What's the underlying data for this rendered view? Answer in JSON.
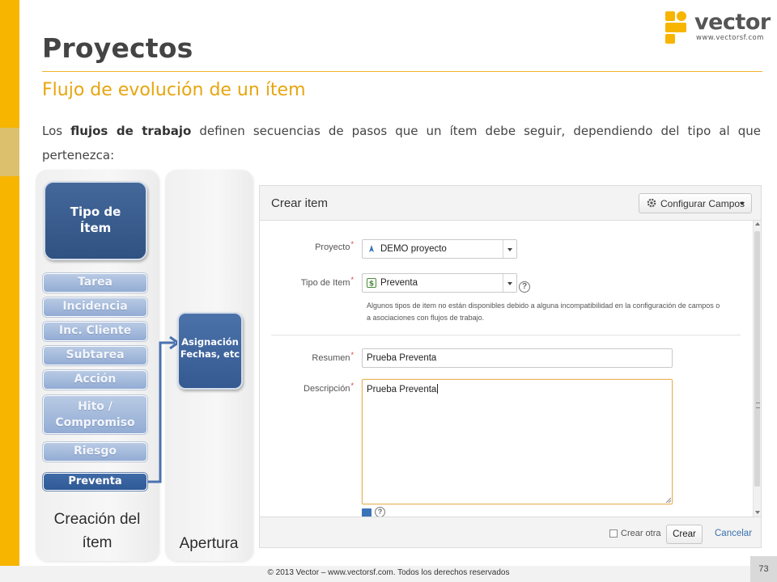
{
  "slide": {
    "title": "Proyectos",
    "subtitle": "Flujo de evolución de un ítem",
    "body_prefix": "Los ",
    "body_bold": "flujos de trabajo",
    "body_suffix": " definen secuencias de pasos que un ítem debe seguir, dependiendo del tipo al que pertenezca:",
    "footer": "© 2013 Vector – www.vectorsf.com. Todos los derechos reservados",
    "page_number": "73"
  },
  "logo": {
    "word": "vector",
    "url": "www.vectorsf.com",
    "color": "#f7b500"
  },
  "flow": {
    "tipo_line1": "Tipo de",
    "tipo_line2": "Ítem",
    "types": [
      "Tarea",
      "Incidencia",
      "Inc. Cliente",
      "Subtarea",
      "Acción",
      "Hito /",
      "Compromiso",
      "Riesgo",
      "Preventa"
    ],
    "active_type": "Preventa",
    "column1_line1": "Creación del",
    "column1_line2": "ítem",
    "column2": "Apertura",
    "step_line1": "Asignación",
    "step_line2": "Fechas, etc",
    "arrow_color": "#4a72b0"
  },
  "dialog": {
    "title": "Crear item",
    "config_button": "Configurar Campos",
    "fields": {
      "proyecto_label": "Proyecto",
      "proyecto_value": "DEMO proyecto",
      "tipo_label": "Tipo de Item",
      "tipo_value": "Preventa",
      "note": "Algunos tipos de item no están disponibles debido a alguna incompatibilidad en la configuración de campos o a asociaciones con flujos de trabajo.",
      "resumen_label": "Resumen",
      "resumen_value": "Prueba Preventa",
      "descripcion_label": "Descripción",
      "descripcion_value": "Prueba Preventa",
      "required_mark": "*",
      "help_glyph": "?"
    },
    "footer": {
      "crear_otra": "Crear otra",
      "crear_otra_checked": false,
      "crear": "Crear",
      "cancelar": "Cancelar"
    }
  }
}
